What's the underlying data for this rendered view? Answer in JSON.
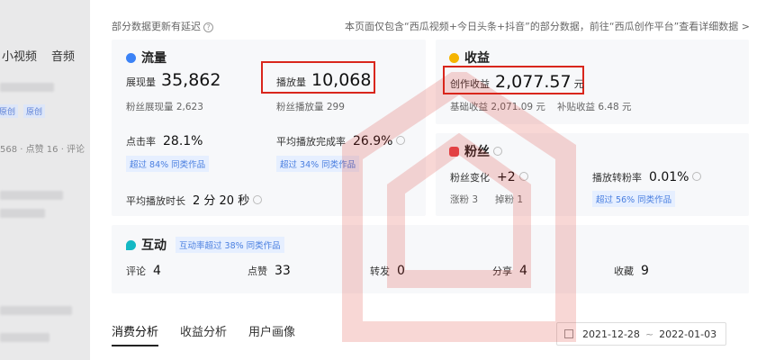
{
  "background": {
    "tabs": [
      "小视频",
      "音频"
    ],
    "meta": "568 · 点赞 16 · 评论",
    "tag1": "原创",
    "tag2": "原创"
  },
  "notice": {
    "left": "部分数据更新有延迟",
    "right": "本页面仅包含“西瓜视频+今日头条+抖音”的部分数据，前往“西瓜创作平台”查看详细数据 >"
  },
  "traffic": {
    "title": "流量",
    "impressions_label": "展现量",
    "impressions_value": "35,862",
    "plays_label": "播放量",
    "plays_value": "10,068",
    "fan_impressions": "粉丝展现量 2,623",
    "fan_plays": "粉丝播放量 299",
    "ctr_label": "点击率",
    "ctr_value": "28.1%",
    "ctr_badge": "超过 84% 同类作品",
    "completion_label": "平均播放完成率",
    "completion_value": "26.9%",
    "completion_badge": "超过 34% 同类作品",
    "duration_label": "平均播放时长",
    "duration_value": "2 分 20 秒"
  },
  "income": {
    "title": "收益",
    "label": "创作收益",
    "value": "2,077.57",
    "unit": "元",
    "base": "基础收益 2,071.09 元",
    "subsidy": "补贴收益 6.48 元"
  },
  "fans": {
    "title": "粉丝",
    "change_label": "粉丝变化",
    "change_value": "+2",
    "gain": "涨粉 3",
    "loss": "掉粉 1",
    "conv_label": "播放转粉率",
    "conv_value": "0.01%",
    "conv_badge": "超过 56% 同类作品"
  },
  "interaction": {
    "title": "互动",
    "badge": "互动率超过 38% 同类作品",
    "items": [
      {
        "label": "评论",
        "value": "4"
      },
      {
        "label": "点赞",
        "value": "33"
      },
      {
        "label": "转发",
        "value": "0"
      },
      {
        "label": "分享",
        "value": "4"
      },
      {
        "label": "收藏",
        "value": "9"
      }
    ]
  },
  "tabs": [
    "消费分析",
    "收益分析",
    "用户画像"
  ],
  "dates": {
    "start": "2021-12-28",
    "sep": "~",
    "end": "2022-01-03"
  },
  "colors": {
    "highlight": "#d9261c",
    "accent": "#4a7fe0",
    "traffic_icon": "#3b82f6",
    "income_icon": "#f5b400",
    "fans_icon": "#e5484d",
    "interaction_icon": "#14b8c4"
  }
}
